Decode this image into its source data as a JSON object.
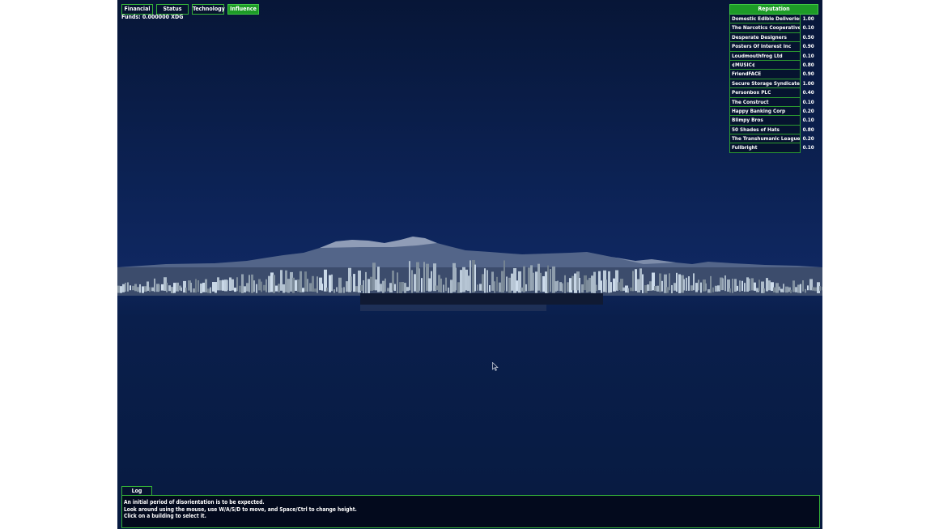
{
  "tabs": [
    {
      "label": "Financial",
      "active": false
    },
    {
      "label": "Status",
      "active": false
    },
    {
      "label": "Technology",
      "active": false
    },
    {
      "label": "Influence",
      "active": true
    }
  ],
  "funds_text": "Funds: 0.000000 XDG",
  "reputation": {
    "title": "Reputation",
    "rows": [
      {
        "name": "Domestic Edible Deliveries",
        "value": "1.00"
      },
      {
        "name": "The Narcotics Cooperative",
        "value": "0.10"
      },
      {
        "name": "Desperate Designers",
        "value": "0.50"
      },
      {
        "name": "Posters Of Interest Inc",
        "value": "0.90"
      },
      {
        "name": "Loudmouthfrog Ltd",
        "value": "0.10"
      },
      {
        "name": "¢MUSIC¢",
        "value": "0.80"
      },
      {
        "name": "FriendFACE",
        "value": "0.90"
      },
      {
        "name": "Secure Storage Syndicate",
        "value": "1.00"
      },
      {
        "name": "Personbox PLC",
        "value": "0.40"
      },
      {
        "name": "The Construct",
        "value": "0.10"
      },
      {
        "name": "Happy Banking Corp",
        "value": "0.20"
      },
      {
        "name": "Blimpy Bros",
        "value": "0.10"
      },
      {
        "name": "50 Shades of Hats",
        "value": "0.80"
      },
      {
        "name": "The Transhumanic League",
        "value": "0.20"
      },
      {
        "name": "Fullbright",
        "value": "0.10"
      }
    ]
  },
  "log": {
    "tab_label": "Log",
    "lines": [
      "An initial period of disorientation is to be expected.",
      "Look around using the mouse, use W/A/S/D to move, and Space/Ctrl to change height.",
      "Click on a building to select it."
    ]
  },
  "colors": {
    "accent_green": "#1d9b27",
    "border_green": "#35b338",
    "panel_bg": "#06132f",
    "sky": "#0d2459"
  }
}
